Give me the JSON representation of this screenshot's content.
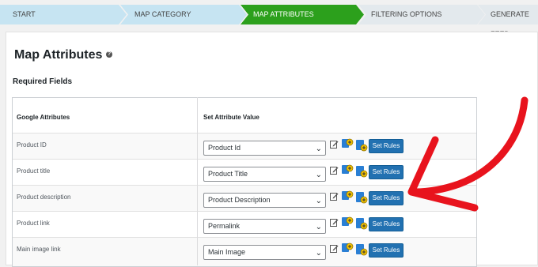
{
  "wizard": {
    "steps": [
      {
        "label": "START",
        "state": "done"
      },
      {
        "label": "MAP CATEGORY",
        "state": "done"
      },
      {
        "label": "MAP ATTRIBUTES",
        "state": "active"
      },
      {
        "label": "FILTERING OPTIONS",
        "state": "pending"
      },
      {
        "label": "GENERATE FEED",
        "state": "pending"
      }
    ]
  },
  "page": {
    "title": "Map Attributes",
    "help_icon": "?",
    "section_title": "Required Fields"
  },
  "table": {
    "headers": {
      "attribute": "Google Attributes",
      "value": "Set Attribute Value"
    },
    "rows": [
      {
        "attribute": "Product ID",
        "value": "Product Id",
        "button": "Set Rules"
      },
      {
        "attribute": "Product title",
        "value": "Product Title",
        "button": "Set Rules"
      },
      {
        "attribute": "Product description",
        "value": "Product Description",
        "button": "Set Rules"
      },
      {
        "attribute": "Product link",
        "value": "Permalink",
        "button": "Set Rules"
      },
      {
        "attribute": "Main image link",
        "value": "Main Image",
        "button": "Set Rules"
      }
    ]
  },
  "icons": {
    "edit": "edit-icon",
    "condition": "add-condition-icon",
    "add_value": "add-value-icon",
    "dropdown": "chevron-down-icon"
  },
  "colors": {
    "step_done": "#c6e4f2",
    "step_active": "#2ca01c",
    "step_pending": "#e3e9ed",
    "button": "#2271b1",
    "annotation_arrow": "#e8131d"
  }
}
